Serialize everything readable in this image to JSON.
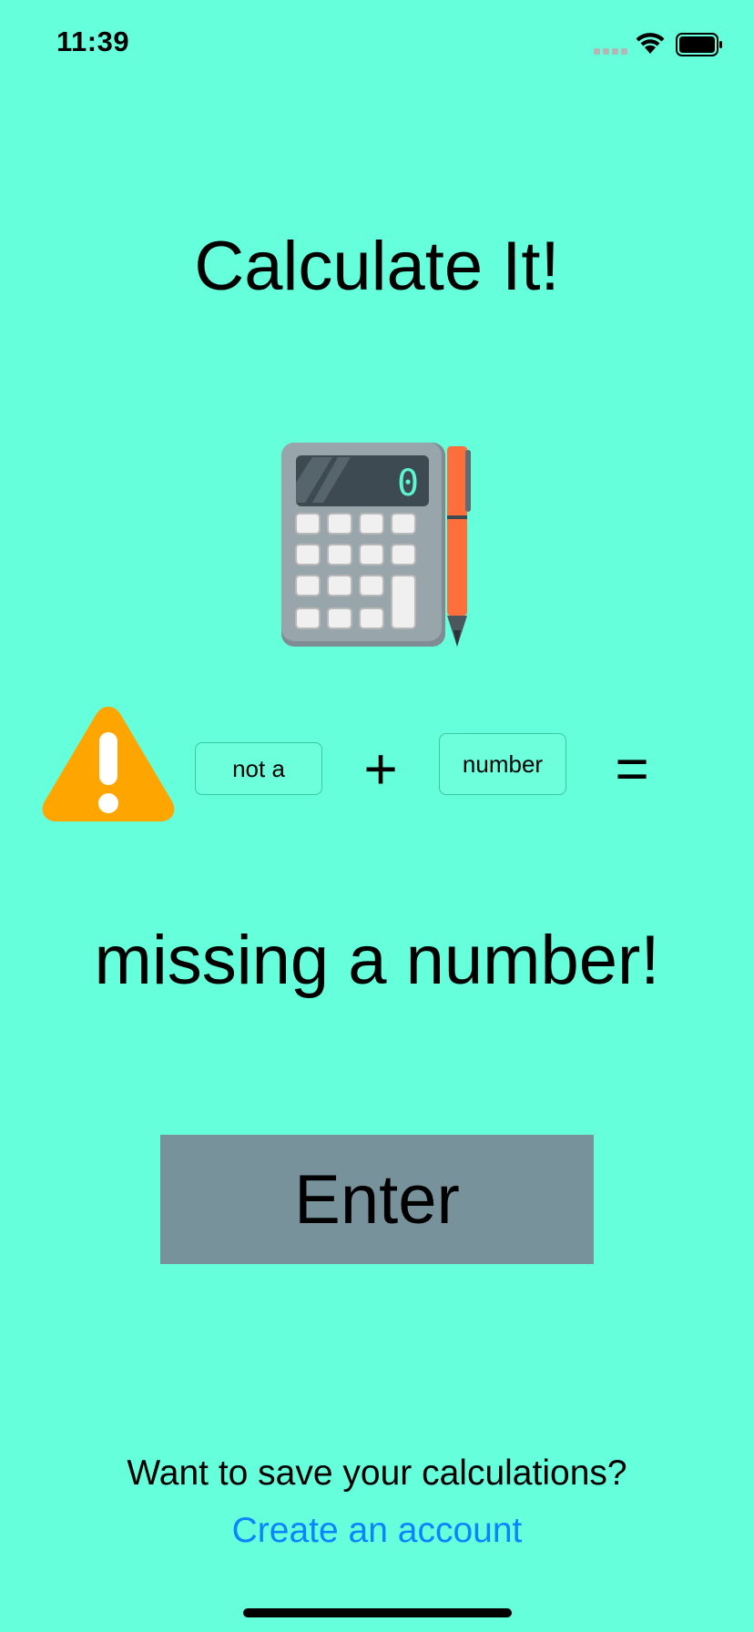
{
  "status_bar": {
    "time": "11:39",
    "signal_icon": "cellular-signal-icon",
    "wifi_icon": "wifi-icon",
    "battery_icon": "battery-full-icon"
  },
  "header": {
    "title": "Calculate It!"
  },
  "illustration": {
    "icon": "calculator-pen-icon",
    "display_value": "0"
  },
  "equation": {
    "warning_icon": "warning-icon",
    "first_field_value": "not a",
    "operator": "+",
    "second_field_value": "number",
    "equals": "="
  },
  "result": {
    "text": "missing a number!"
  },
  "actions": {
    "enter_label": "Enter"
  },
  "footer": {
    "prompt": "Want to save your calculations?",
    "link_label": "Create an account"
  },
  "colors": {
    "background": "#66FFDB",
    "button": "#78929B",
    "link": "#0A84FF",
    "warning": "#FFA500"
  }
}
